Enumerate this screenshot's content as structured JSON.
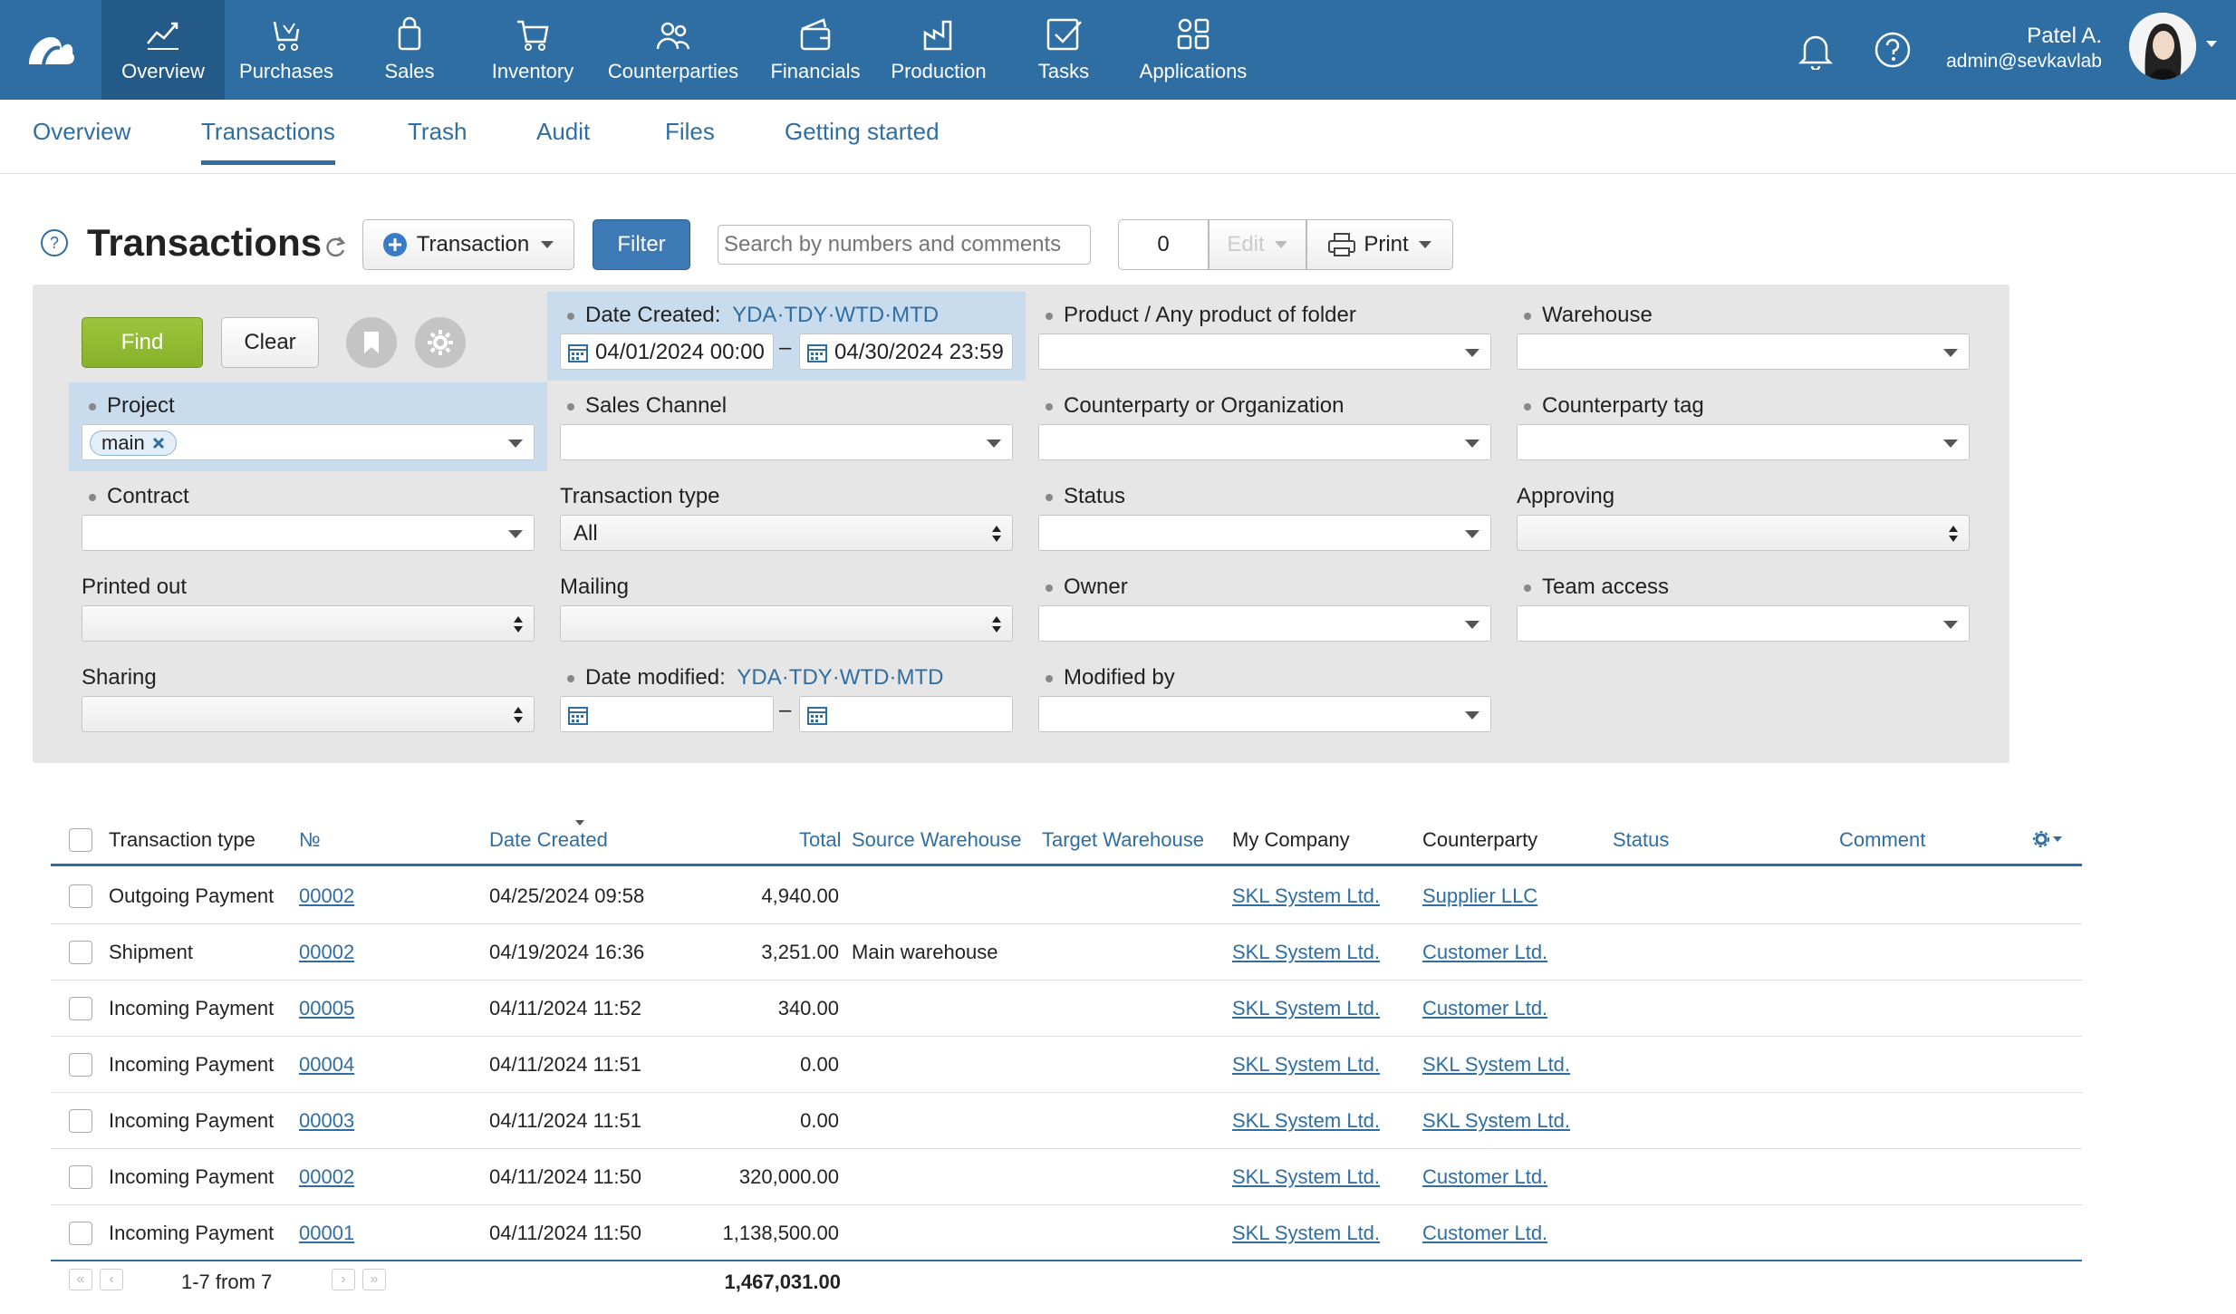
{
  "nav": {
    "items": [
      {
        "label": "Overview",
        "icon": "chart-line-icon"
      },
      {
        "label": "Purchases",
        "icon": "cart-hand-icon"
      },
      {
        "label": "Sales",
        "icon": "shopping-bag-icon"
      },
      {
        "label": "Inventory",
        "icon": "cart-icon"
      },
      {
        "label": "Counterparties",
        "icon": "people-icon"
      },
      {
        "label": "Financials",
        "icon": "wallet-icon"
      },
      {
        "label": "Production",
        "icon": "factory-icon"
      },
      {
        "label": "Tasks",
        "icon": "checkbox-icon"
      },
      {
        "label": "Applications",
        "icon": "apps-grid-icon"
      }
    ],
    "active": "Overview"
  },
  "user": {
    "name": "Patel A.",
    "email": "admin@sevkavlab"
  },
  "subnav": {
    "tabs": [
      "Overview",
      "Transactions",
      "Trash",
      "Audit",
      "Files",
      "Getting started"
    ],
    "active": "Transactions"
  },
  "toolbar": {
    "title": "Transactions",
    "transaction_btn": "Transaction",
    "filter_btn": "Filter",
    "search_placeholder": "Search by numbers and comments",
    "count": "0",
    "edit_btn": "Edit",
    "print_btn": "Print"
  },
  "filters": {
    "find": "Find",
    "clear": "Clear",
    "date_created_label": "Date Created:",
    "quick": [
      "YDA",
      "TDY",
      "WTD",
      "MTD"
    ],
    "date_from": "04/01/2024 00:00",
    "date_to": "04/30/2024 23:59",
    "product_label": "Product / Any product of folder",
    "warehouse_label": "Warehouse",
    "project_label": "Project",
    "project_tag": "main",
    "sales_channel_label": "Sales Channel",
    "counterparty_label": "Counterparty or Organization",
    "counterparty_tag_label": "Counterparty tag",
    "contract_label": "Contract",
    "transaction_type_label": "Transaction type",
    "transaction_type_value": "All",
    "status_label": "Status",
    "approving_label": "Approving",
    "printed_label": "Printed out",
    "mailing_label": "Mailing",
    "owner_label": "Owner",
    "team_label": "Team access",
    "sharing_label": "Sharing",
    "date_modified_label": "Date modified:",
    "modified_by_label": "Modified by"
  },
  "table": {
    "headers": {
      "type": "Transaction type",
      "num": "№",
      "date": "Date Created",
      "total": "Total",
      "source": "Source Warehouse",
      "target": "Target Warehouse",
      "company": "My Company",
      "counterparty": "Counterparty",
      "status": "Status",
      "comment": "Comment"
    },
    "rows": [
      {
        "type": "Outgoing Payment",
        "num": "00002",
        "date": "04/25/2024 09:58",
        "total": "4,940.00",
        "source": "",
        "company": "SKL System Ltd.",
        "counterparty": "Supplier LLC"
      },
      {
        "type": "Shipment",
        "num": "00002",
        "date": "04/19/2024 16:36",
        "total": "3,251.00",
        "source": "Main warehouse",
        "company": "SKL System Ltd.",
        "counterparty": "Customer Ltd."
      },
      {
        "type": "Incoming Payment",
        "num": "00005",
        "date": "04/11/2024 11:52",
        "total": "340.00",
        "source": "",
        "company": "SKL System Ltd.",
        "counterparty": "Customer Ltd."
      },
      {
        "type": "Incoming Payment",
        "num": "00004",
        "date": "04/11/2024 11:51",
        "total": "0.00",
        "source": "",
        "company": "SKL System Ltd.",
        "counterparty": "SKL System Ltd."
      },
      {
        "type": "Incoming Payment",
        "num": "00003",
        "date": "04/11/2024 11:51",
        "total": "0.00",
        "source": "",
        "company": "SKL System Ltd.",
        "counterparty": "SKL System Ltd."
      },
      {
        "type": "Incoming Payment",
        "num": "00002",
        "date": "04/11/2024 11:50",
        "total": "320,000.00",
        "source": "",
        "company": "SKL System Ltd.",
        "counterparty": "Customer Ltd."
      },
      {
        "type": "Incoming Payment",
        "num": "00001",
        "date": "04/11/2024 11:50",
        "total": "1,138,500.00",
        "source": "",
        "company": "SKL System Ltd.",
        "counterparty": "Customer Ltd."
      }
    ],
    "pagination": "1-7 from 7",
    "grand_total": "1,467,031.00"
  },
  "colors": {
    "brand": "#2f6ea3",
    "find": "#8cb52f",
    "filter": "#3d79b5"
  }
}
